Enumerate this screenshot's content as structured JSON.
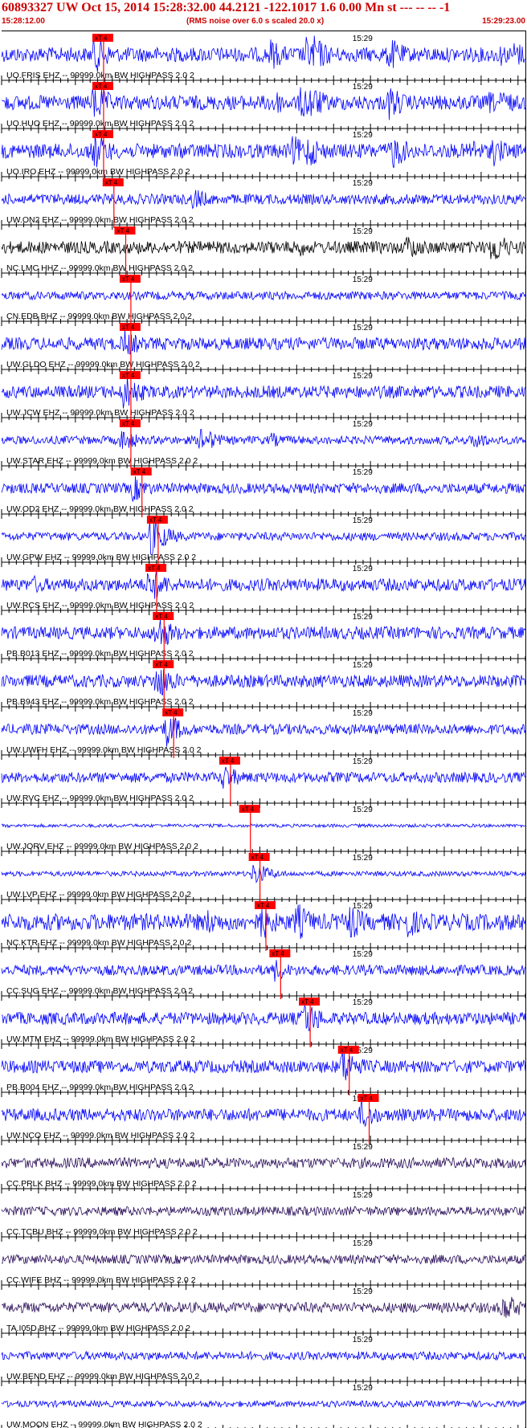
{
  "header": {
    "title": "60893327 UW Oct 15, 2014 15:28:32.00   44.2121 -122.1017  1.6 0.00 Mn st --- -- --   -1",
    "start_time": "15:28:12.00",
    "noise_note": "(RMS noise over 6.0 s scaled 20.0 x)",
    "end_time": "15:29:23.00"
  },
  "colors": {
    "header_text": "#cc0000",
    "trace_blue": "#0000ff",
    "trace_black": "#000000",
    "trace_purple": "#2a0e5a",
    "pick_marker": "#ff0000",
    "grid": "#000000"
  },
  "chart_data": {
    "type": "seismogram",
    "time_axis": {
      "start": "15:28:12.00",
      "end": "15:29:23.00",
      "duration_s": 71,
      "minute_label": "15:29",
      "minute_offset_s": 48
    },
    "pick_label": "xT 4",
    "traces": [
      {
        "label": "UO.FRIS EHZ -- 99999.0km BW  HIGHPASS  2.0  2",
        "color": "blue",
        "pick_s": 12.3,
        "amp": 0.35,
        "events": [
          [
            12.5,
            1.0
          ],
          [
            36.5,
            0.8
          ],
          [
            41.2,
            0.9
          ],
          [
            42.2,
            1.0
          ],
          [
            52.5,
            0.9
          ],
          [
            67.5,
            0.6
          ],
          [
            69.5,
            0.7
          ]
        ]
      },
      {
        "label": "UO.HUO EHZ -- 99999.0km BW  HIGHPASS  2.0  2",
        "color": "blue",
        "pick_s": 12.3,
        "amp": 0.35,
        "events": [
          [
            12.5,
            1.0
          ],
          [
            36.5,
            0.8
          ],
          [
            40.6,
            0.9
          ],
          [
            41.6,
            1.0
          ],
          [
            52.5,
            0.9
          ],
          [
            66.0,
            0.6
          ],
          [
            67.8,
            0.7
          ]
        ]
      },
      {
        "label": "UO.IRO EHZ -- 99999.0km BW  HIGHPASS  2.0  2",
        "color": "blue",
        "pick_s": 12.3,
        "amp": 0.35,
        "events": [
          [
            12.5,
            1.0
          ],
          [
            39.5,
            0.8
          ],
          [
            41.5,
            0.9
          ],
          [
            52.8,
            1.0
          ],
          [
            63.5,
            0.7
          ],
          [
            66.5,
            0.8
          ]
        ]
      },
      {
        "label": "UW.ON2 EHZ -- 99999.0km BW  HIGHPASS  2.0  2",
        "color": "blue",
        "pick_s": 13.7,
        "amp": 0.25,
        "events": [
          [
            26.0,
            0.6
          ]
        ]
      },
      {
        "label": "NC.LMC HHZ -- 99999.0km BW  HIGHPASS  2.0  2",
        "color": "black",
        "pick_s": 15.3,
        "amp": 0.3,
        "events": [
          [
            40.0,
            0.55
          ],
          [
            55.0,
            0.7
          ],
          [
            66.5,
            0.9
          ]
        ]
      },
      {
        "label": "CN.EDB BHZ -- 99999.0km BW  HIGHPASS  2.0  2",
        "color": "blue",
        "pick_s": 16.0,
        "amp": 0.2,
        "events": []
      },
      {
        "label": "UW.GLDO EHZ -- 99999.0km BW  HIGHPASS  2.0  2",
        "color": "blue",
        "pick_s": 16.0,
        "amp": 0.3,
        "events": [
          [
            16.5,
            0.8
          ]
        ]
      },
      {
        "label": "UW.JCW EHZ -- 99999.0km BW  HIGHPASS  2.0  2",
        "color": "blue",
        "pick_s": 16.0,
        "amp": 0.3,
        "events": [
          [
            16.5,
            1.0
          ]
        ]
      },
      {
        "label": "UW.STAR EHZ -- 99999.0km BW  HIGHPASS  2.0  2",
        "color": "blue",
        "pick_s": 16.0,
        "amp": 0.2,
        "events": [
          [
            16.3,
            0.6
          ],
          [
            27.0,
            0.7
          ],
          [
            36.5,
            0.4
          ],
          [
            64.0,
            0.5
          ]
        ]
      },
      {
        "label": "UW.OD2 EHZ -- 99999.0km BW  HIGHPASS  2.0  2",
        "color": "blue",
        "pick_s": 17.5,
        "amp": 0.25,
        "events": [
          [
            17.8,
            0.7
          ]
        ]
      },
      {
        "label": "UW.GPW EHZ -- 99999.0km BW  HIGHPASS  2.0  2",
        "color": "blue",
        "pick_s": 19.7,
        "amp": 0.2,
        "events": [
          [
            20.2,
            1.0
          ]
        ]
      },
      {
        "label": "UW.RCS EHZ -- 99999.0km BW  HIGHPASS  2.0  2",
        "color": "blue",
        "pick_s": 19.5,
        "amp": 0.3,
        "events": [
          [
            4.5,
            0.5
          ],
          [
            20.0,
            1.0
          ]
        ]
      },
      {
        "label": "PB.B013 EHZ -- 99999.0km BW  HIGHPASS  2.0  2",
        "color": "blue",
        "pick_s": 20.5,
        "amp": 0.3,
        "events": [
          [
            21.0,
            1.0
          ]
        ]
      },
      {
        "label": "PB.B943 EHZ -- 99999.0km BW  HIGHPASS  2.0  2",
        "color": "blue",
        "pick_s": 20.5,
        "amp": 0.3,
        "events": [
          [
            21.0,
            1.0
          ]
        ]
      },
      {
        "label": "UW.UWFH EHZ -- 99999.0km BW  HIGHPASS  2.0  2",
        "color": "blue",
        "pick_s": 21.8,
        "amp": 0.25,
        "events": [
          [
            22.3,
            0.9
          ]
        ]
      },
      {
        "label": "UW.RVC EHZ -- 99999.0km BW  HIGHPASS  2.0  2",
        "color": "blue",
        "pick_s": 29.5,
        "amp": 0.25,
        "events": [
          [
            30.0,
            0.7
          ]
        ]
      },
      {
        "label": "UW.JORV EHZ -- 99999.0km BW  HIGHPASS  2.0  2",
        "color": "blue",
        "pick_s": 32.2,
        "amp": 0.08,
        "events": []
      },
      {
        "label": "UW.LVP EHZ -- 99999.0km BW  HIGHPASS  2.0  2",
        "color": "blue",
        "pick_s": 33.5,
        "amp": 0.12,
        "events": [
          [
            34.2,
            0.6
          ]
        ]
      },
      {
        "label": "NC.KTR EHZ -- 99999.0km BW  HIGHPASS  2.0  2",
        "color": "blue",
        "pick_s": 34.3,
        "amp": 0.4,
        "events": [
          [
            28.0,
            0.7
          ],
          [
            35.0,
            1.0
          ],
          [
            40.0,
            1.0
          ],
          [
            47.0,
            1.0
          ],
          [
            55.0,
            0.85
          ]
        ]
      },
      {
        "label": "CC.SUG EHZ -- 99999.0km BW  HIGHPASS  2.0  2",
        "color": "blue",
        "pick_s": 36.3,
        "amp": 0.25,
        "events": [
          [
            37.0,
            0.6
          ]
        ]
      },
      {
        "label": "UW.MTM EHZ -- 99999.0km BW  HIGHPASS  2.0  2",
        "color": "blue",
        "pick_s": 40.3,
        "amp": 0.3,
        "events": [
          [
            41.0,
            1.0
          ]
        ]
      },
      {
        "label": "PB.B004 EHZ -- 99999.0km BW  HIGHPASS  2.0  2",
        "color": "blue",
        "pick_s": 45.6,
        "amp": 0.3,
        "events": [
          [
            46.2,
            1.0
          ]
        ]
      },
      {
        "label": "UW.NCO EHZ -- 99999.0km BW  HIGHPASS  2.0  2",
        "color": "blue",
        "pick_s": 48.3,
        "amp": 0.3,
        "events": [
          [
            48.8,
            0.8
          ]
        ]
      },
      {
        "label": "CC.PRLK BHZ -- 99999.0km BW  HIGHPASS  2.0  2",
        "color": "purple",
        "pick_s": null,
        "amp": 0.25,
        "events": []
      },
      {
        "label": "CC.TCBU BHZ -- 99999.0km BW  HIGHPASS  2.0  2",
        "color": "purple",
        "pick_s": null,
        "amp": 0.22,
        "events": []
      },
      {
        "label": "CC.WIFE BHZ -- 99999.0km BW  HIGHPASS  2.0  2",
        "color": "purple",
        "pick_s": null,
        "amp": 0.22,
        "events": []
      },
      {
        "label": "TA.I05D BHZ -- 99999.0km BW  HIGHPASS  2.0  2",
        "color": "purple",
        "pick_s": null,
        "amp": 0.25,
        "events": [
          [
            68.0,
            0.8
          ]
        ]
      },
      {
        "label": "UW.BEND EHZ -- 99999.0km BW  HIGHPASS  2.0  2",
        "color": "blue",
        "pick_s": null,
        "amp": 0.2,
        "events": []
      },
      {
        "label": "UW.MOON EHZ -- 99999.0km BW  HIGHPASS  2.0  2",
        "color": "blue",
        "pick_s": null,
        "amp": 0.15,
        "events": []
      }
    ]
  }
}
